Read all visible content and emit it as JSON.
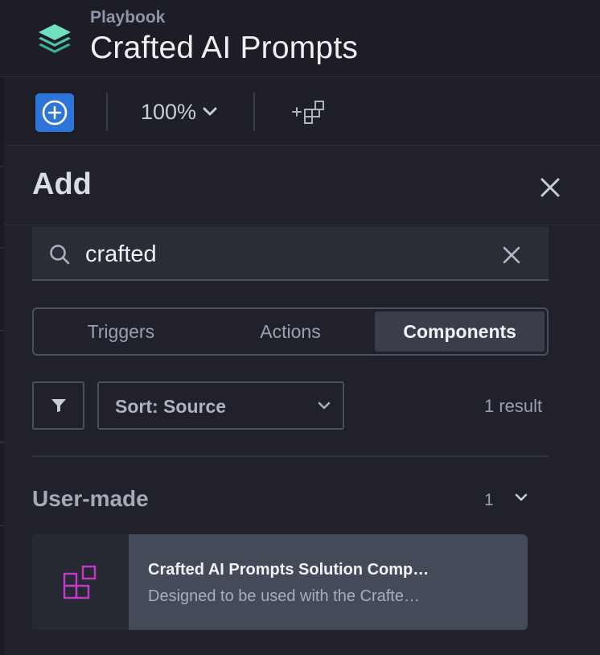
{
  "header": {
    "subtitle": "Playbook",
    "title": "Crafted AI Prompts",
    "logo_icon": "layers-stack-icon",
    "logo_color": "#5fd3b0"
  },
  "toolbar": {
    "add_icon": "plus-circle-icon",
    "zoom_label": "100%",
    "add_component_icon": "add-component-icon",
    "accent": "#2f74d8"
  },
  "panel": {
    "title": "Add",
    "close_icon": "close-icon",
    "search": {
      "value": "crafted",
      "placeholder": ""
    },
    "tabs": [
      {
        "label": "Triggers",
        "active": false
      },
      {
        "label": "Actions",
        "active": false
      },
      {
        "label": "Components",
        "active": true
      }
    ],
    "filter_icon": "filter-icon",
    "sort_label": "Sort: Source",
    "result_count": "1 result",
    "group": {
      "title": "User-made",
      "count": "1"
    },
    "card": {
      "title": "Crafted AI Prompts Solution Comp…",
      "description": "Designed to be used with the Crafte…",
      "icon": "component-blocks-icon",
      "icon_color": "#c43bc9"
    }
  }
}
